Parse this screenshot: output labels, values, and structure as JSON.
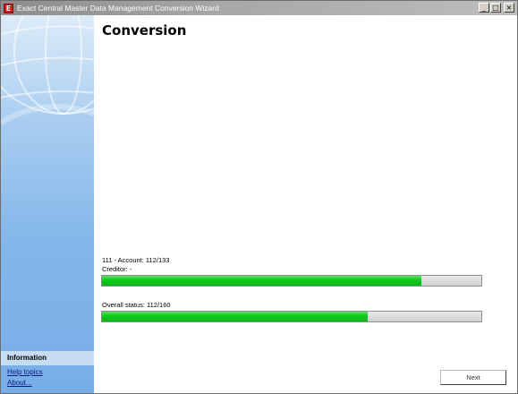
{
  "window": {
    "title": "Exact Central Master Data Management Conversion Wizard",
    "app_icon_letter": "E",
    "controls": {
      "minimize": "_",
      "maximize": "□",
      "close": "×"
    }
  },
  "sidebar": {
    "info_header": "Information",
    "links": {
      "help": "Help topics",
      "about": "About..."
    }
  },
  "main": {
    "title": "Conversion",
    "account_status": "111 - Account: 112/133",
    "creditor_status": "Creditor: -",
    "overall_status": "Overall status: 112/160",
    "progress": {
      "account": 0.842,
      "overall": 0.7
    }
  },
  "buttons": {
    "next": "Next"
  },
  "colors": {
    "progress_fill": "#0fcb1f",
    "sidebar": "#83b6ea",
    "titlebar": "#a8a8a8"
  }
}
